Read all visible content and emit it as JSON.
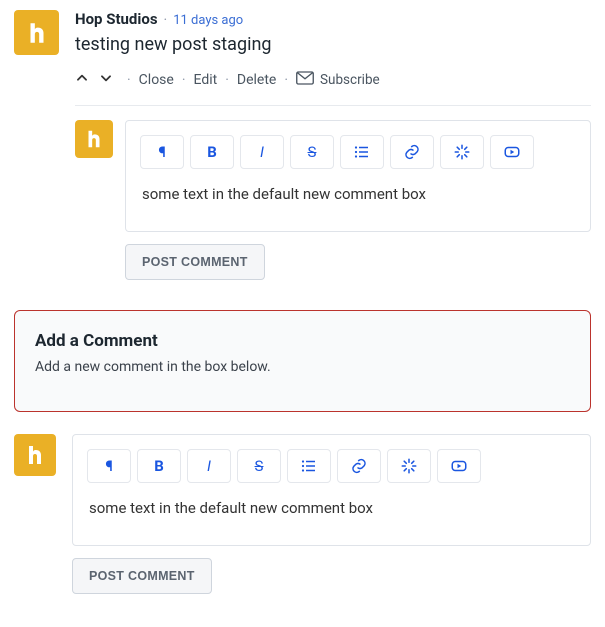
{
  "post": {
    "author": "Hop Studios",
    "timestamp": "11 days ago",
    "title": "testing new post staging",
    "actions": {
      "close": "Close",
      "edit": "Edit",
      "delete": "Delete",
      "subscribe": "Subscribe"
    }
  },
  "reply": {
    "content": "some text in the default new comment box",
    "submit": "Post Comment"
  },
  "alert": {
    "title": "Add a Comment",
    "text": "Add a new comment in the box below."
  },
  "newcomment": {
    "content": "some text in the default new comment box",
    "submit": "Post Comment"
  }
}
